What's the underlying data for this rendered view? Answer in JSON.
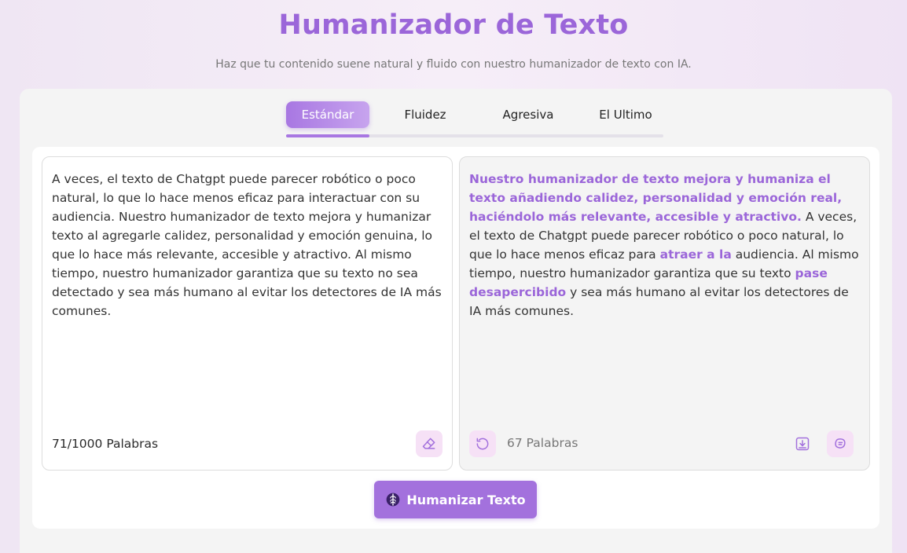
{
  "header": {
    "title": "Humanizador de Texto",
    "subtitle": "Haz que tu contenido suene natural y fluido con nuestro humanizador de texto con IA."
  },
  "tabs": [
    {
      "label": "Estándar",
      "active": true
    },
    {
      "label": "Fluidez",
      "active": false
    },
    {
      "label": "Agresiva",
      "active": false
    },
    {
      "label": "El Ultimo",
      "active": false
    }
  ],
  "input": {
    "text": "A veces, el texto de Chatgpt puede parecer robótico o poco natural, lo que lo hace menos eficaz para interactuar con su audiencia. Nuestro humanizador de texto mejora y humanizar texto al agregarle calidez, personalidad y emoción genuina, lo que lo hace más relevante, accesible y atractivo. Al mismo tiempo, nuestro humanizador garantiza que su texto no sea detectado y sea más humano al evitar los detectores de IA más comunes.",
    "word_count": "71/1000 Palabras",
    "clear_icon": "eraser-icon"
  },
  "output": {
    "segments": [
      {
        "text": "Nuestro humanizador de texto mejora y humaniza el texto añadiendo calidez, personalidad y emoción real, haciéndolo más relevante, accesible y atractivo.",
        "highlight": true
      },
      {
        "text": " A veces, el texto de Chatgpt puede parecer robótico o poco natural, lo que lo hace menos eficaz para ",
        "highlight": false
      },
      {
        "text": "atraer a la",
        "highlight": true
      },
      {
        "text": " audiencia. Al mismo tiempo, nuestro humanizador garantiza que su texto ",
        "highlight": false
      },
      {
        "text": "pase desapercibido",
        "highlight": true
      },
      {
        "text": " y sea más humano al evitar los detectores de IA más comunes.",
        "highlight": false
      }
    ],
    "word_count": "67 Palabras",
    "regenerate_icon": "refresh-icon",
    "download_icon": "download-icon",
    "copy_icon": "copy-icon"
  },
  "action": {
    "label": "Humanizar Texto",
    "icon": "brain-icon"
  },
  "colors": {
    "accent": "#9b66d9",
    "button": "#a371dd",
    "icon_bg": "#f6e1f6"
  }
}
